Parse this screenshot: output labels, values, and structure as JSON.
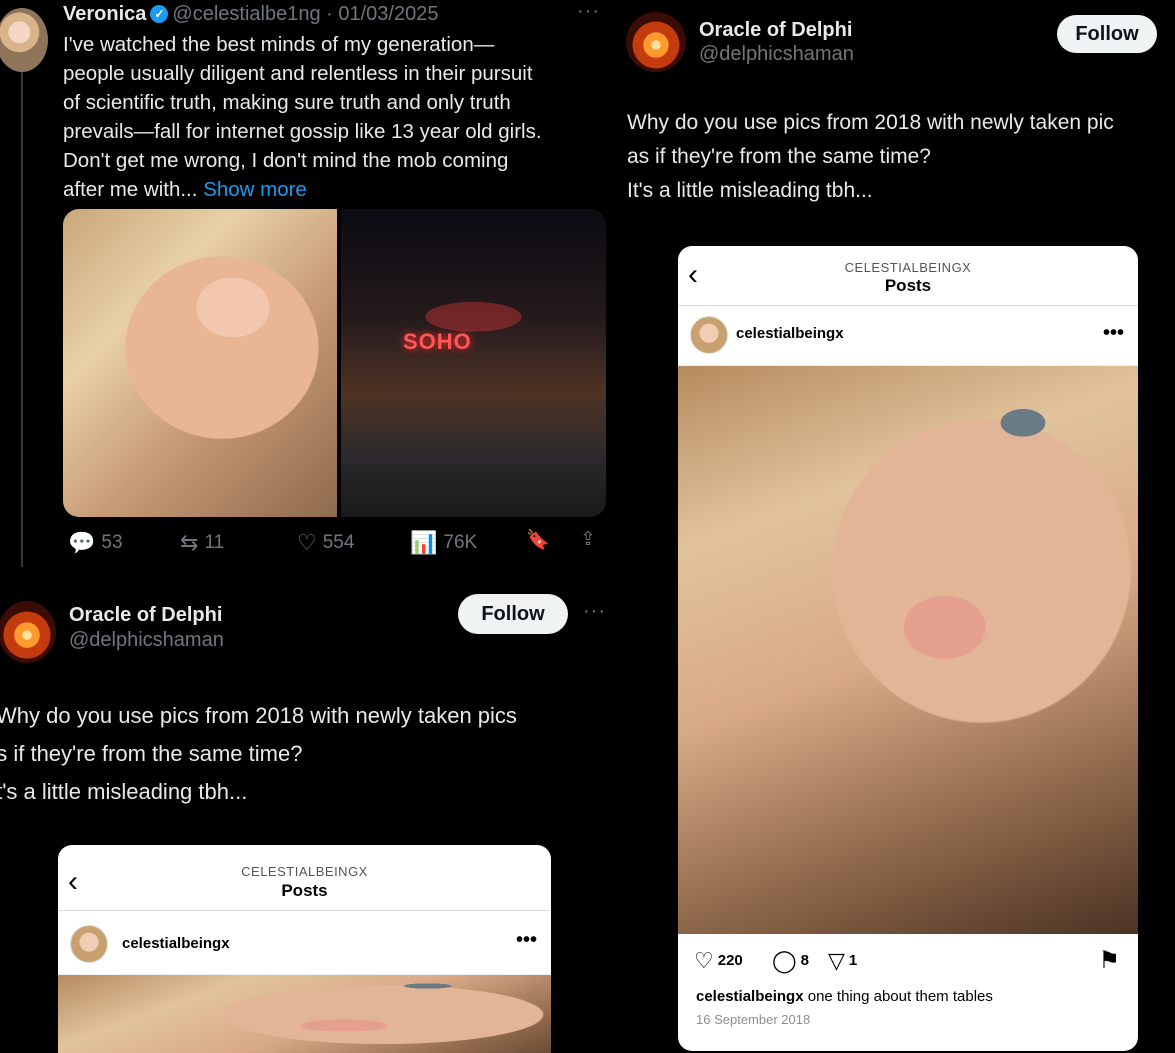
{
  "tweet": {
    "display_name": "Veronica",
    "verified_glyph": "✓",
    "handle_date": "@celestialbe1ng · 01/03/2025",
    "more": "···",
    "body_lines": [
      "I've watched the best minds of my generation—",
      "people usually diligent and relentless in their pursuit",
      "of scientific truth, making sure truth and only truth",
      "prevails—fall for internet gossip like 13 year old girls.",
      "Don't get me wrong, I don't mind the mob coming",
      "after me with..."
    ],
    "show_more": "Show more",
    "street_sign": "SOHO",
    "actions": {
      "replies": "53",
      "reposts": "11",
      "likes": "554",
      "views": "76K"
    },
    "icons": {
      "reply": "💬",
      "repost": "⇆",
      "like": "♡",
      "views": "📊",
      "bookmark": "🔖",
      "share": "⇪"
    }
  },
  "reply": {
    "display_name": "Oracle of Delphi",
    "handle": "@delphicshaman",
    "follow_label": "Follow",
    "more": "···",
    "text_lines": [
      "Why do you use pics from 2018 with newly taken pics",
      "as if they're from the same time?",
      "It's a little misleading tbh..."
    ]
  },
  "reply_right": {
    "display_name": "Oracle of Delphi",
    "handle": "@delphicshaman",
    "follow_label": "Follow",
    "text_lines": [
      "Why do you use pics from 2018 with newly taken pic",
      "as if they're from the same time?",
      "It's a little misleading tbh..."
    ]
  },
  "instagram": {
    "back_glyph": "‹",
    "account": "CELESTIALBEINGX",
    "section": "Posts",
    "username": "celestialbeingx",
    "more": "•••",
    "likes": "220",
    "comments": "8",
    "shares": "1",
    "icons": {
      "like": "♡",
      "comment": "◯",
      "share": "▽",
      "save": "⚑"
    },
    "caption_user": "celestialbeingx",
    "caption_text": " one thing about them tables",
    "date": "16 September 2018"
  },
  "colors": {
    "background": "#000000",
    "text_primary": "#e7e9ea",
    "text_secondary": "#71767b",
    "link_blue": "#1d9bf0",
    "follow_button_bg": "#eff3f4"
  }
}
